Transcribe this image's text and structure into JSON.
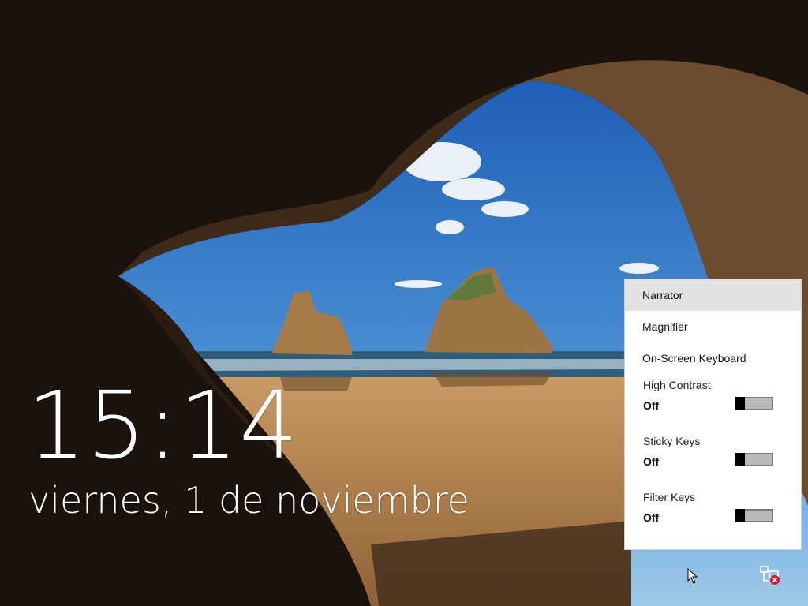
{
  "lock_screen": {
    "time": "15:14",
    "date": "viernes, 1 de noviembre"
  },
  "ease_of_access_menu": {
    "items": [
      {
        "label": "Narrator",
        "selected": true
      },
      {
        "label": "Magnifier",
        "selected": false
      },
      {
        "label": "On-Screen Keyboard",
        "selected": false
      }
    ],
    "toggles": [
      {
        "label": "High Contrast",
        "state": "Off"
      },
      {
        "label": "Sticky Keys",
        "state": "Off"
      },
      {
        "label": "Filter Keys",
        "state": "Off"
      }
    ]
  },
  "taskbar_icons": {
    "network": "network-disconnected-icon",
    "pointer": "mouse-pointer-icon"
  },
  "colors": {
    "menu_background": "#ffffff",
    "menu_selected": "#e2e2e2",
    "toggle_off": "#b9b9b9",
    "text_on_wallpaper": "#ffffff",
    "error_badge": "#e81123"
  }
}
